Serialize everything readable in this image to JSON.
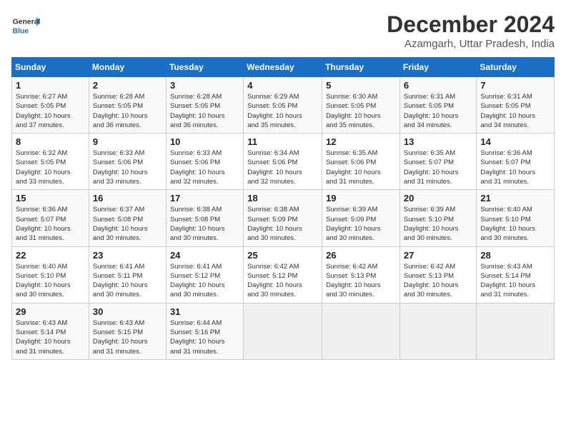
{
  "header": {
    "logo_general": "General",
    "logo_blue": "Blue",
    "title": "December 2024",
    "subtitle": "Azamgarh, Uttar Pradesh, India"
  },
  "days_of_week": [
    "Sunday",
    "Monday",
    "Tuesday",
    "Wednesday",
    "Thursday",
    "Friday",
    "Saturday"
  ],
  "weeks": [
    [
      {
        "day": "1",
        "info": "Sunrise: 6:27 AM\nSunset: 5:05 PM\nDaylight: 10 hours\nand 37 minutes."
      },
      {
        "day": "2",
        "info": "Sunrise: 6:28 AM\nSunset: 5:05 PM\nDaylight: 10 hours\nand 36 minutes."
      },
      {
        "day": "3",
        "info": "Sunrise: 6:28 AM\nSunset: 5:05 PM\nDaylight: 10 hours\nand 36 minutes."
      },
      {
        "day": "4",
        "info": "Sunrise: 6:29 AM\nSunset: 5:05 PM\nDaylight: 10 hours\nand 35 minutes."
      },
      {
        "day": "5",
        "info": "Sunrise: 6:30 AM\nSunset: 5:05 PM\nDaylight: 10 hours\nand 35 minutes."
      },
      {
        "day": "6",
        "info": "Sunrise: 6:31 AM\nSunset: 5:05 PM\nDaylight: 10 hours\nand 34 minutes."
      },
      {
        "day": "7",
        "info": "Sunrise: 6:31 AM\nSunset: 5:05 PM\nDaylight: 10 hours\nand 34 minutes."
      }
    ],
    [
      {
        "day": "8",
        "info": "Sunrise: 6:32 AM\nSunset: 5:05 PM\nDaylight: 10 hours\nand 33 minutes."
      },
      {
        "day": "9",
        "info": "Sunrise: 6:33 AM\nSunset: 5:06 PM\nDaylight: 10 hours\nand 33 minutes."
      },
      {
        "day": "10",
        "info": "Sunrise: 6:33 AM\nSunset: 5:06 PM\nDaylight: 10 hours\nand 32 minutes."
      },
      {
        "day": "11",
        "info": "Sunrise: 6:34 AM\nSunset: 5:06 PM\nDaylight: 10 hours\nand 32 minutes."
      },
      {
        "day": "12",
        "info": "Sunrise: 6:35 AM\nSunset: 5:06 PM\nDaylight: 10 hours\nand 31 minutes."
      },
      {
        "day": "13",
        "info": "Sunrise: 6:35 AM\nSunset: 5:07 PM\nDaylight: 10 hours\nand 31 minutes."
      },
      {
        "day": "14",
        "info": "Sunrise: 6:36 AM\nSunset: 5:07 PM\nDaylight: 10 hours\nand 31 minutes."
      }
    ],
    [
      {
        "day": "15",
        "info": "Sunrise: 6:36 AM\nSunset: 5:07 PM\nDaylight: 10 hours\nand 31 minutes."
      },
      {
        "day": "16",
        "info": "Sunrise: 6:37 AM\nSunset: 5:08 PM\nDaylight: 10 hours\nand 30 minutes."
      },
      {
        "day": "17",
        "info": "Sunrise: 6:38 AM\nSunset: 5:08 PM\nDaylight: 10 hours\nand 30 minutes."
      },
      {
        "day": "18",
        "info": "Sunrise: 6:38 AM\nSunset: 5:09 PM\nDaylight: 10 hours\nand 30 minutes."
      },
      {
        "day": "19",
        "info": "Sunrise: 6:39 AM\nSunset: 5:09 PM\nDaylight: 10 hours\nand 30 minutes."
      },
      {
        "day": "20",
        "info": "Sunrise: 6:39 AM\nSunset: 5:10 PM\nDaylight: 10 hours\nand 30 minutes."
      },
      {
        "day": "21",
        "info": "Sunrise: 6:40 AM\nSunset: 5:10 PM\nDaylight: 10 hours\nand 30 minutes."
      }
    ],
    [
      {
        "day": "22",
        "info": "Sunrise: 6:40 AM\nSunset: 5:10 PM\nDaylight: 10 hours\nand 30 minutes."
      },
      {
        "day": "23",
        "info": "Sunrise: 6:41 AM\nSunset: 5:11 PM\nDaylight: 10 hours\nand 30 minutes."
      },
      {
        "day": "24",
        "info": "Sunrise: 6:41 AM\nSunset: 5:12 PM\nDaylight: 10 hours\nand 30 minutes."
      },
      {
        "day": "25",
        "info": "Sunrise: 6:42 AM\nSunset: 5:12 PM\nDaylight: 10 hours\nand 30 minutes."
      },
      {
        "day": "26",
        "info": "Sunrise: 6:42 AM\nSunset: 5:13 PM\nDaylight: 10 hours\nand 30 minutes."
      },
      {
        "day": "27",
        "info": "Sunrise: 6:42 AM\nSunset: 5:13 PM\nDaylight: 10 hours\nand 30 minutes."
      },
      {
        "day": "28",
        "info": "Sunrise: 6:43 AM\nSunset: 5:14 PM\nDaylight: 10 hours\nand 31 minutes."
      }
    ],
    [
      {
        "day": "29",
        "info": "Sunrise: 6:43 AM\nSunset: 5:14 PM\nDaylight: 10 hours\nand 31 minutes."
      },
      {
        "day": "30",
        "info": "Sunrise: 6:43 AM\nSunset: 5:15 PM\nDaylight: 10 hours\nand 31 minutes."
      },
      {
        "day": "31",
        "info": "Sunrise: 6:44 AM\nSunset: 5:16 PM\nDaylight: 10 hours\nand 31 minutes."
      },
      {
        "day": "",
        "info": ""
      },
      {
        "day": "",
        "info": ""
      },
      {
        "day": "",
        "info": ""
      },
      {
        "day": "",
        "info": ""
      }
    ]
  ]
}
